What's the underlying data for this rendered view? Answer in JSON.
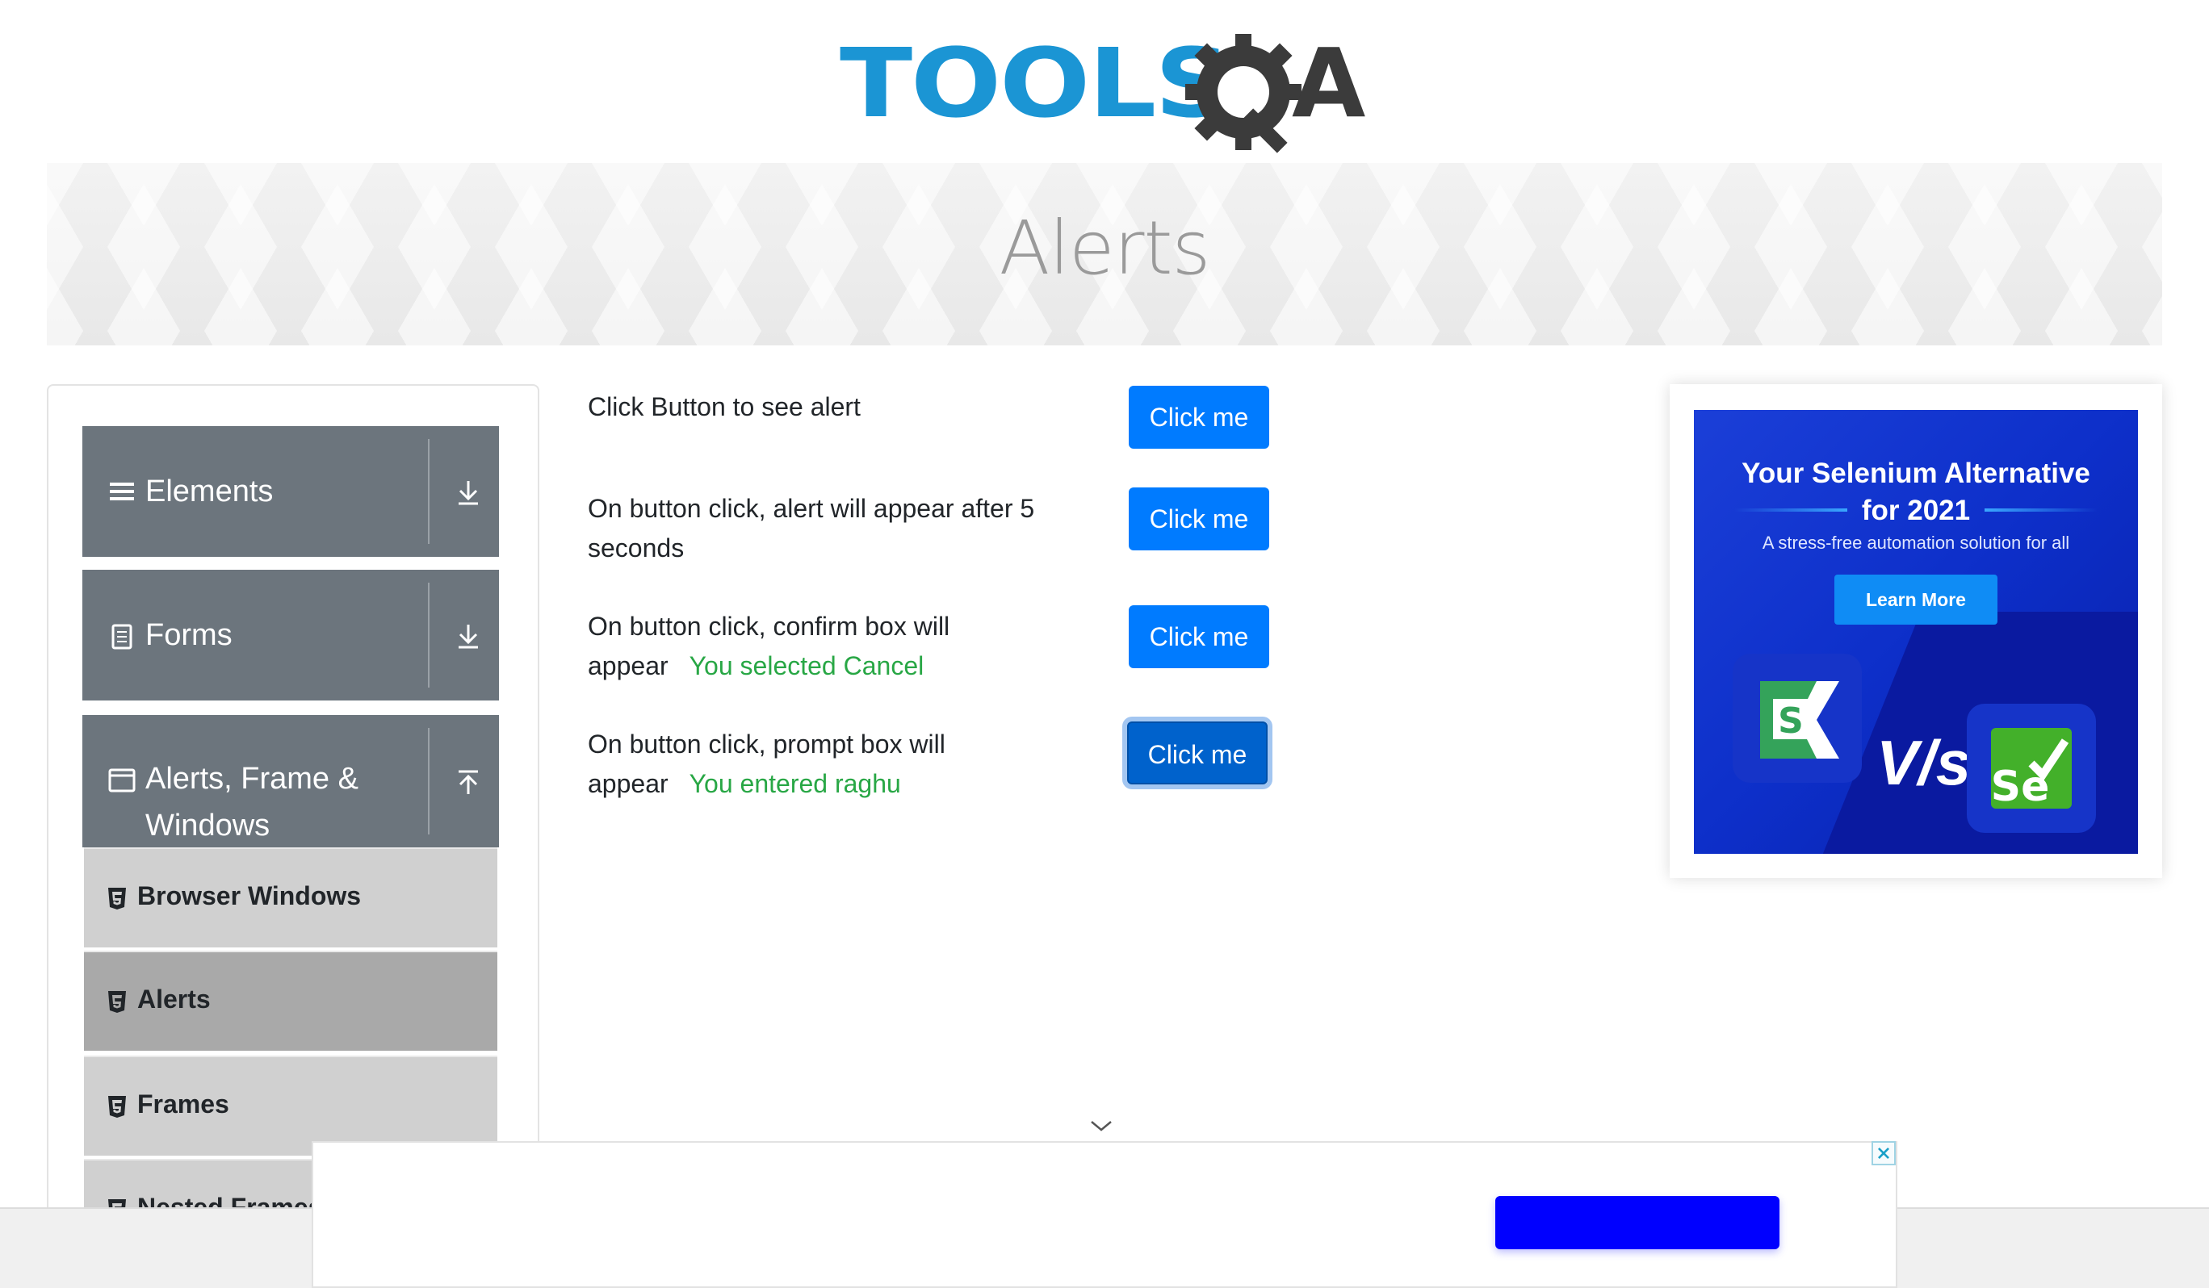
{
  "header": {
    "logo_tools": "TOOLS",
    "logo_a": "A"
  },
  "banner": {
    "title": "Alerts"
  },
  "sidebar": {
    "groups": [
      {
        "label": "Elements",
        "icon": "hamburger-icon",
        "arrow": "download-arrow-icon"
      },
      {
        "label": "Forms",
        "icon": "document-icon",
        "arrow": "download-arrow-icon"
      },
      {
        "label": "Alerts, Frame & Windows",
        "icon": "window-icon",
        "arrow": "upload-arrow-icon",
        "expanded": true
      }
    ],
    "items": [
      {
        "label": "Browser Windows",
        "active": false
      },
      {
        "label": "Alerts",
        "active": true
      },
      {
        "label": "Frames",
        "active": false
      },
      {
        "label": "Nested Frames",
        "active": false
      }
    ]
  },
  "main": {
    "rows": [
      {
        "text": "Click Button to see alert",
        "button": "Click me",
        "result": ""
      },
      {
        "text_line1": "On button click, alert will appear after 5",
        "text_line2": "seconds",
        "button": "Click me",
        "result": ""
      },
      {
        "text_line1": "On button click, confirm box will",
        "text_line2": "appear",
        "button": "Click me",
        "result": "You selected Cancel"
      },
      {
        "text_line1": "On button click, prompt box will",
        "text_line2": "appear",
        "button": "Click me",
        "result": "You entered raghu"
      }
    ]
  },
  "ad": {
    "title_line1": "Your Selenium Alternative",
    "title_line2": "for 2021",
    "subtitle": "A stress-free automation solution for all",
    "button": "Learn More",
    "vs": "V/s",
    "logo_left": "S",
    "logo_right": "Se"
  },
  "colors": {
    "primary": "#007bff",
    "success": "#28a745",
    "sidebar_group": "#6c757d",
    "sidebar_item": "#d0d0d0",
    "sidebar_item_active": "#a9a9a9",
    "logo_blue": "#1b95d4"
  }
}
